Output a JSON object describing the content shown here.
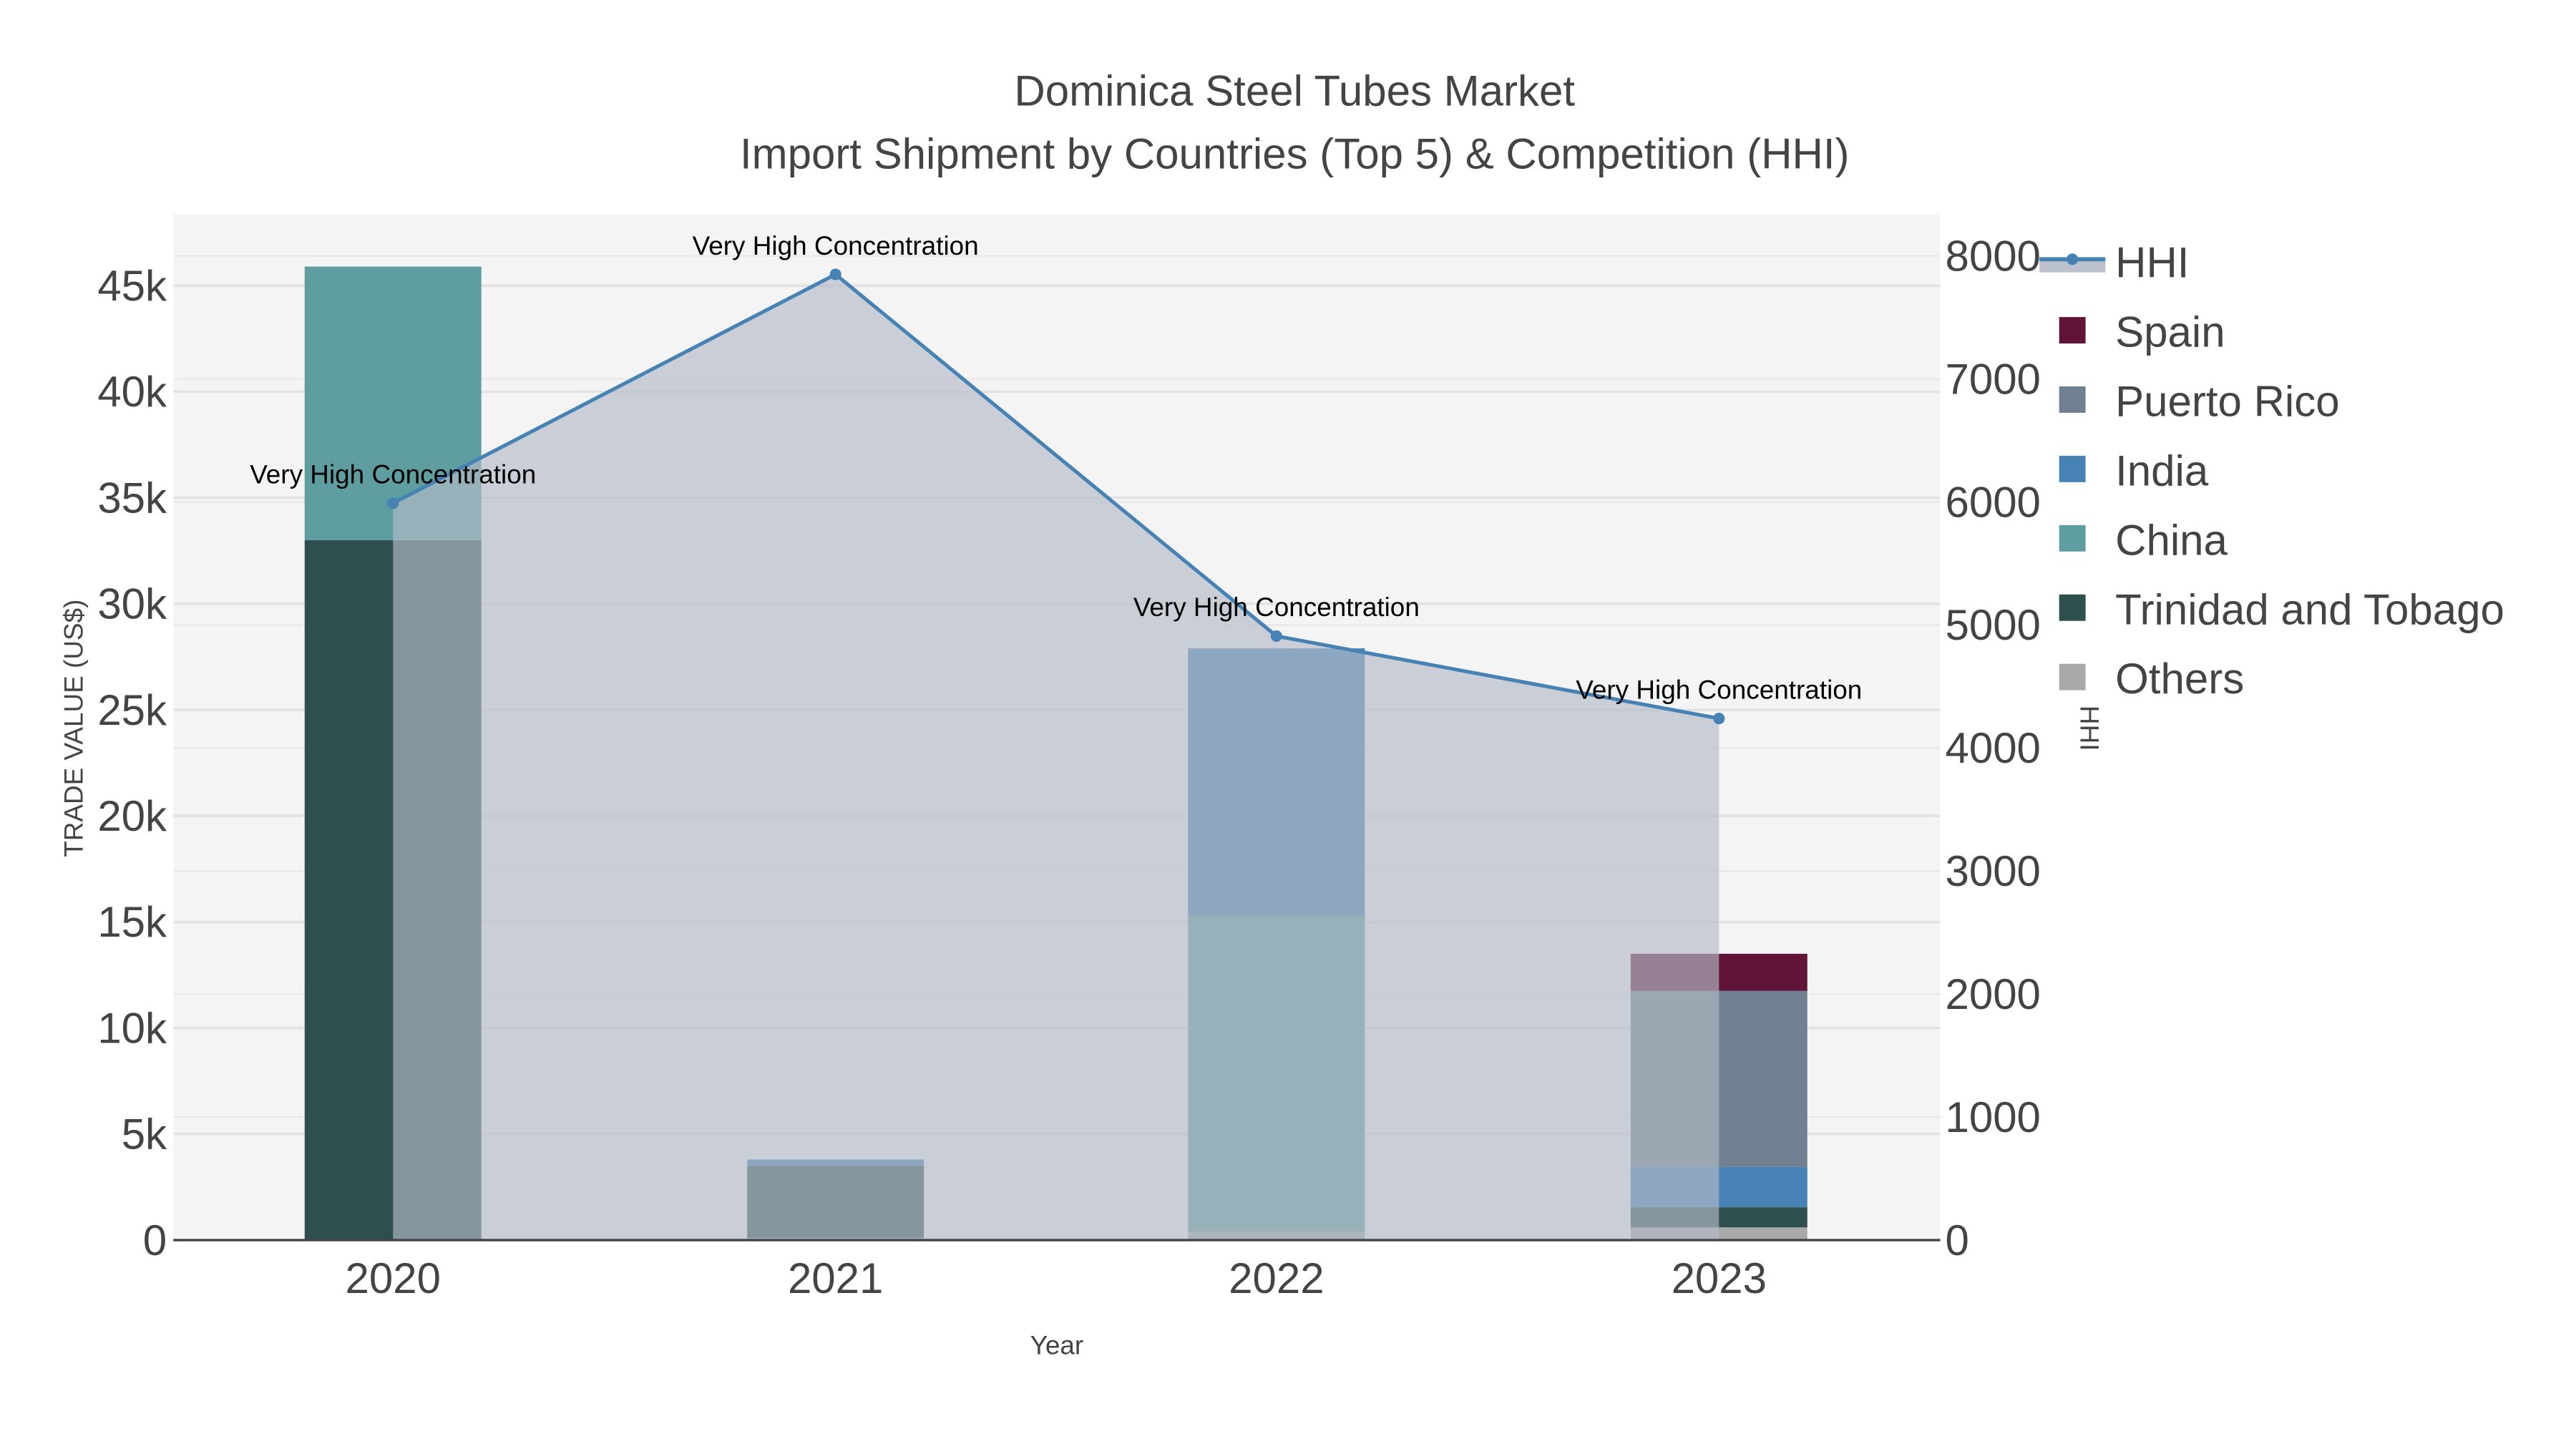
{
  "chart_data": {
    "type": "bar",
    "title": "Dominica Steel Tubes Market",
    "subtitle": "Import Shipment by Countries (Top 5) & Competition (HHI)",
    "xlabel": "Year",
    "ylabel": "TRADE VALUE (US$)",
    "y2label": "HHI",
    "categories": [
      "2020",
      "2021",
      "2022",
      "2023"
    ],
    "ylim": [
      0,
      48000
    ],
    "yticks": [
      0,
      5000,
      10000,
      15000,
      20000,
      25000,
      30000,
      35000,
      40000,
      45000
    ],
    "ytick_labels": [
      "0",
      "5k",
      "10k",
      "15k",
      "20k",
      "25k",
      "30k",
      "35k",
      "40k",
      "45k"
    ],
    "y2lim": [
      0,
      8350
    ],
    "y2ticks": [
      0,
      1000,
      2000,
      3000,
      4000,
      5000,
      6000,
      7000,
      8000
    ],
    "y2tick_labels": [
      "0",
      "1000",
      "2000",
      "3000",
      "4000",
      "5000",
      "6000",
      "7000",
      "8000"
    ],
    "series": [
      {
        "name": "Others",
        "color": "#a9a9a9",
        "values": [
          0,
          100,
          400,
          600
        ]
      },
      {
        "name": "Trinidad and Tobago",
        "color": "#2f4f4f",
        "values": [
          33000,
          3400,
          0,
          950
        ]
      },
      {
        "name": "China",
        "color": "#5f9ea0",
        "values": [
          12900,
          0,
          14900,
          0
        ]
      },
      {
        "name": "India",
        "color": "#4682b4",
        "values": [
          0,
          300,
          12600,
          1900
        ]
      },
      {
        "name": "Puerto Rico",
        "color": "#708090",
        "values": [
          0,
          0,
          0,
          8300
        ]
      },
      {
        "name": "Spain",
        "color": "#601438",
        "values": [
          0,
          0,
          0,
          1750
        ]
      }
    ],
    "hhi": {
      "name": "HHI",
      "color": "#4682b4",
      "values": [
        5990,
        7850,
        4910,
        4240
      ],
      "annotations": [
        "Very High Concentration",
        "Very High Concentration",
        "Very High Concentration",
        "Very High Concentration"
      ]
    },
    "legend": [
      "HHI",
      "Spain",
      "Puerto Rico",
      "India",
      "China",
      "Trinidad and Tobago",
      "Others"
    ],
    "legend_placement": "right",
    "grid": true
  }
}
